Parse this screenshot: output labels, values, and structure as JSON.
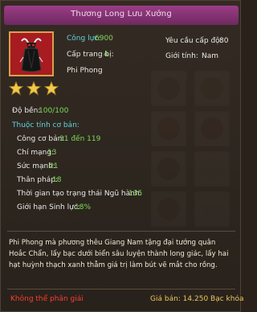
{
  "item": {
    "name": "Thương Long Lưu Xưởng",
    "type": "Phi Phong",
    "attack_power_label": "Công lực:",
    "attack_power_value": "6900",
    "level_label": "Cấp trang bị:",
    "level_value": "4",
    "required_level_label": "Yêu cầu cấp độ:",
    "required_level_value": "80",
    "gender_label": "Giới tính:",
    "gender_value": "Nam",
    "stars": 3,
    "durability_label": "Độ bền:",
    "durability_value": "100/100"
  },
  "base_attributes": {
    "heading": "Thuộc tính cơ bản:",
    "rows": [
      {
        "label": "Công cơ bản:",
        "value": "31 đến 119"
      },
      {
        "label": "Chí mạng:",
        "value": "13"
      },
      {
        "label": "Sức mạnh:",
        "value": "21"
      },
      {
        "label": "Thân pháp:",
        "value": "18"
      },
      {
        "label": "Thời gian tạo trạng thái Ngũ hành:",
        "value": "135"
      },
      {
        "label": "Giới hạn Sinh lực:",
        "value": "18%"
      }
    ]
  },
  "description": "Phi Phong mà phương thêu Giang Nam tặng đại tướng quân Hoắc Chẩn, lấy bạc dưới biển sâu luyện thành long giác, lấy hai hạt huỳnh thạch xanh thẫm giá trị làm bút vẽ mắt cho rồng.",
  "footer": {
    "not_decomposable": "Không thể phân giải",
    "sell_price": "Giá bán: 14.250 Bạc khóa"
  },
  "colors": {
    "title_bar": "#9c3c86",
    "icon_bg": "#b11f24",
    "accent_green": "#7ed957",
    "accent_cyan": "#5fd2e0",
    "warning_red": "#ff3c2f",
    "price_gold": "#f0c45a"
  },
  "icons": {
    "item_icon": "black-dragon-cape-icon",
    "star_icon": "gold-star-icon"
  }
}
